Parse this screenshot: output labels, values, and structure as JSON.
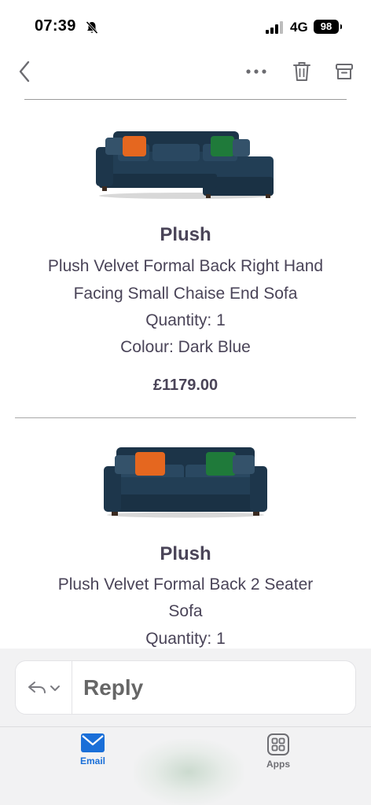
{
  "status": {
    "time": "07:39",
    "network": "4G",
    "battery": "98"
  },
  "products": [
    {
      "brand": "Plush",
      "name_line1": "Plush Velvet Formal Back Right Hand",
      "name_line2": "Facing Small Chaise End Sofa",
      "quantity": "Quantity: 1",
      "colour": "Colour: Dark Blue",
      "price": "£1179.00"
    },
    {
      "brand": "Plush",
      "name_line1": "Plush Velvet Formal Back 2 Seater",
      "name_line2": "Sofa",
      "quantity": "Quantity: 1"
    }
  ],
  "reply": {
    "label": "Reply"
  },
  "tabs": [
    {
      "label": "Email",
      "icon": "envelope-icon",
      "active": true
    },
    {
      "label": "Apps",
      "icon": "grid-icon",
      "active": false
    }
  ],
  "colors": {
    "accent": "#1a6fd8",
    "sofa": "#1f3a4f",
    "cushion_orange": "#e5671f",
    "cushion_green": "#1f7a3a"
  }
}
